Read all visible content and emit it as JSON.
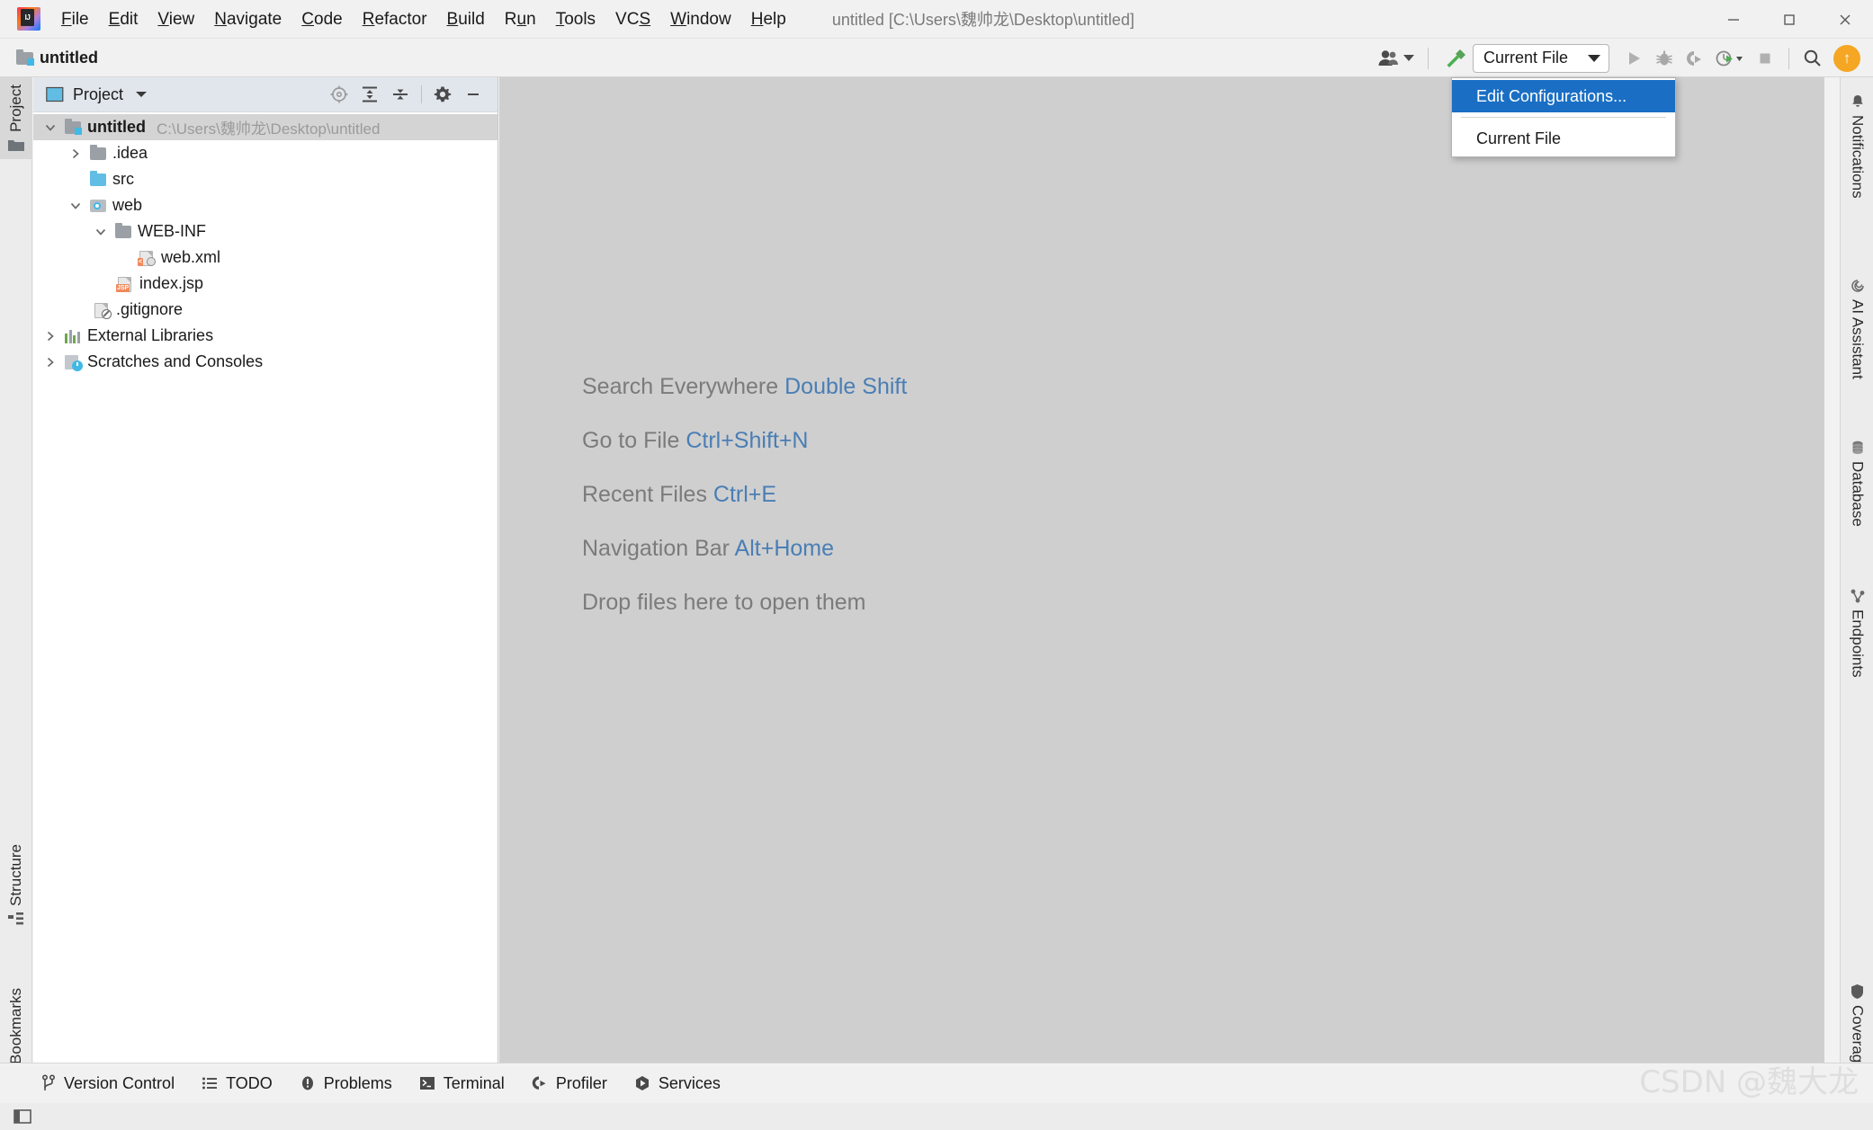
{
  "window": {
    "title": "untitled [C:\\Users\\魏帅龙\\Desktop\\untitled]",
    "minimize_label": "—",
    "maximize_label": "□",
    "close_label": "✕"
  },
  "menubar": {
    "items": [
      {
        "name": "file",
        "pre": "",
        "mn": "F",
        "post": "ile"
      },
      {
        "name": "edit",
        "pre": "",
        "mn": "E",
        "post": "dit"
      },
      {
        "name": "view",
        "pre": "",
        "mn": "V",
        "post": "iew"
      },
      {
        "name": "navigate",
        "pre": "",
        "mn": "N",
        "post": "avigate"
      },
      {
        "name": "code",
        "pre": "",
        "mn": "C",
        "post": "ode"
      },
      {
        "name": "refactor",
        "pre": "",
        "mn": "R",
        "post": "efactor"
      },
      {
        "name": "build",
        "pre": "",
        "mn": "B",
        "post": "uild"
      },
      {
        "name": "run",
        "pre": "R",
        "mn": "u",
        "post": "n"
      },
      {
        "name": "tools",
        "pre": "",
        "mn": "T",
        "post": "ools"
      },
      {
        "name": "vcs",
        "pre": "VC",
        "mn": "S",
        "post": ""
      },
      {
        "name": "window",
        "pre": "",
        "mn": "W",
        "post": "indow"
      },
      {
        "name": "help",
        "pre": "",
        "mn": "H",
        "post": "elp"
      }
    ]
  },
  "navbar": {
    "crumb": "untitled"
  },
  "toolbar": {
    "run_config_label": "Current File",
    "update_badge": "↑"
  },
  "run_config_popup": {
    "edit_configurations": "Edit Configurations...",
    "current_file": "Current File"
  },
  "left_stripe": {
    "project": "Project",
    "structure": "Structure",
    "bookmarks": "Bookmarks"
  },
  "project_panel": {
    "title": "Project",
    "tree": [
      {
        "name": "root-untitled",
        "label": "untitled",
        "path": "C:\\Users\\魏帅龙\\Desktop\\untitled",
        "indent": 0,
        "arrow": "down",
        "icon": "module",
        "bold": true,
        "selected": true
      },
      {
        "name": "idea",
        "label": ".idea",
        "path": "",
        "indent": 1,
        "arrow": "right",
        "icon": "folder",
        "bold": false,
        "selected": false
      },
      {
        "name": "src",
        "label": "src",
        "path": "",
        "indent": 1,
        "arrow": "none",
        "icon": "folder-blue",
        "bold": false,
        "selected": false
      },
      {
        "name": "web",
        "label": "web",
        "path": "",
        "indent": 1,
        "arrow": "down",
        "icon": "web",
        "bold": false,
        "selected": false
      },
      {
        "name": "web-inf",
        "label": "WEB-INF",
        "path": "",
        "indent": 2,
        "arrow": "down",
        "icon": "folder",
        "bold": false,
        "selected": false
      },
      {
        "name": "web-xml",
        "label": "web.xml",
        "path": "",
        "indent": 3,
        "arrow": "none",
        "icon": "xml-file",
        "bold": false,
        "selected": false
      },
      {
        "name": "index-jsp",
        "label": "index.jsp",
        "path": "",
        "indent": 2,
        "arrow": "none",
        "icon": "jsp-file",
        "bold": false,
        "selected": false
      },
      {
        "name": "gitignore",
        "label": ".gitignore",
        "path": "",
        "indent": 1,
        "arrow": "none",
        "icon": "ignore-file",
        "bold": false,
        "selected": false
      },
      {
        "name": "external-libraries",
        "label": "External Libraries",
        "path": "",
        "indent": 0,
        "arrow": "right",
        "icon": "library",
        "bold": false,
        "selected": false
      },
      {
        "name": "scratches",
        "label": "Scratches and Consoles",
        "path": "",
        "indent": 0,
        "arrow": "right",
        "icon": "scratch",
        "bold": false,
        "selected": false
      }
    ]
  },
  "editor": {
    "hints": [
      {
        "name": "search-everywhere",
        "text": "Search Everywhere ",
        "key": "Double Shift"
      },
      {
        "name": "go-to-file",
        "text": "Go to File ",
        "key": "Ctrl+Shift+N"
      },
      {
        "name": "recent-files",
        "text": "Recent Files ",
        "key": "Ctrl+E"
      },
      {
        "name": "navigation-bar",
        "text": "Navigation Bar ",
        "key": "Alt+Home"
      },
      {
        "name": "drop-files",
        "text": "Drop files here to open them",
        "key": ""
      }
    ]
  },
  "right_stripe": {
    "notifications": "Notifications",
    "ai_assistant": "AI Assistant",
    "database": "Database",
    "endpoints": "Endpoints",
    "coverage": "Coverage"
  },
  "statusbar": {
    "items": [
      {
        "name": "version-control",
        "label": "Version Control",
        "icon": "branch-icon"
      },
      {
        "name": "todo",
        "label": "TODO",
        "icon": "list-icon"
      },
      {
        "name": "problems",
        "label": "Problems",
        "icon": "warning-icon"
      },
      {
        "name": "terminal",
        "label": "Terminal",
        "icon": "terminal-icon"
      },
      {
        "name": "profiler",
        "label": "Profiler",
        "icon": "profiler-icon"
      },
      {
        "name": "services",
        "label": "Services",
        "icon": "services-icon"
      }
    ]
  },
  "watermark": {
    "text": "CSDN @魏大龙"
  },
  "colors": {
    "accent_blue": "#1a6fc4",
    "editor_bg": "#cfcfcf",
    "hint_key": "#4a7eb5",
    "badge_orange": "#f5a623",
    "teal": "#4a9a9a"
  }
}
